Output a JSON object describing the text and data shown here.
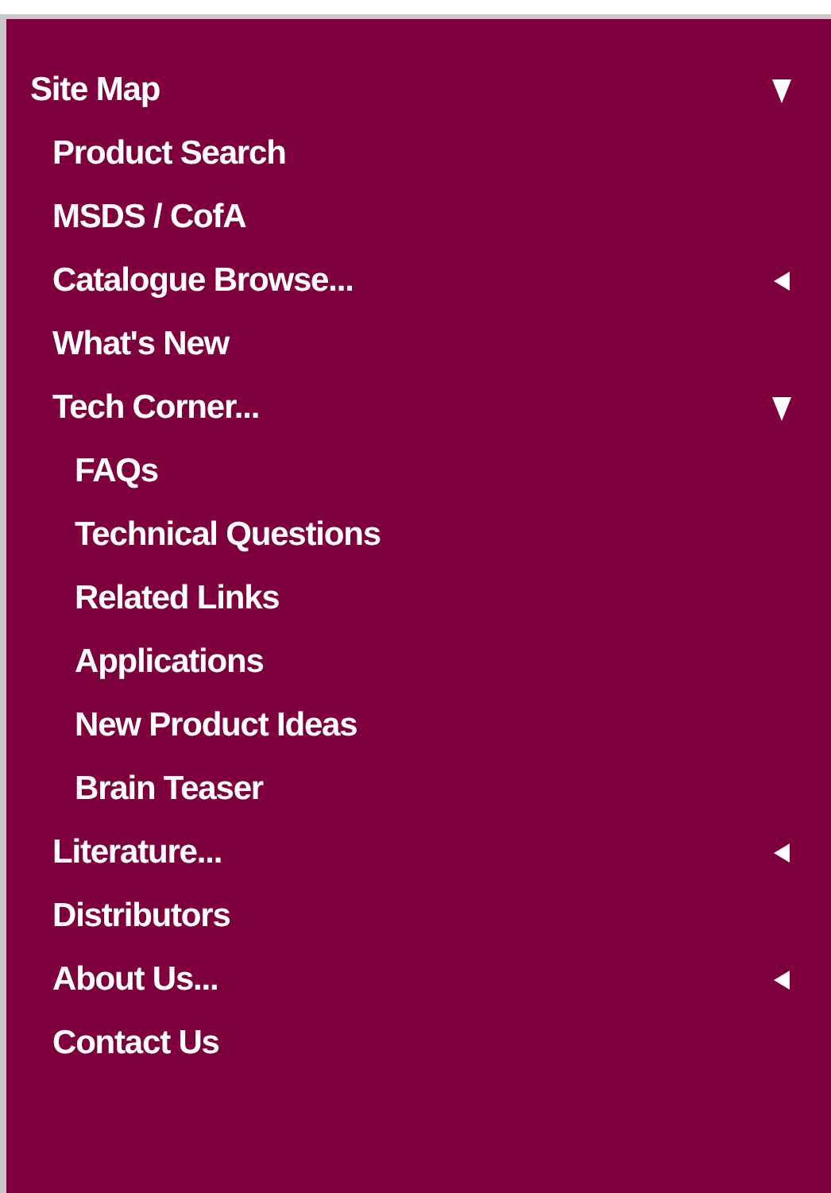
{
  "menu": {
    "label": "Site Map",
    "expanded": true,
    "children": [
      {
        "label": "Product Search"
      },
      {
        "label": "MSDS / CofA"
      },
      {
        "label": "Catalogue Browse...",
        "expanded": false
      },
      {
        "label": "What's New"
      },
      {
        "label": "Tech Corner...",
        "expanded": true,
        "children": [
          {
            "label": "FAQs"
          },
          {
            "label": "Technical Questions"
          },
          {
            "label": "Related Links"
          },
          {
            "label": "Applications"
          },
          {
            "label": "New Product Ideas"
          },
          {
            "label": "Brain Teaser"
          }
        ]
      },
      {
        "label": "Literature...",
        "expanded": false
      },
      {
        "label": "Distributors"
      },
      {
        "label": "About Us...",
        "expanded": false
      },
      {
        "label": "Contact Us"
      }
    ]
  }
}
